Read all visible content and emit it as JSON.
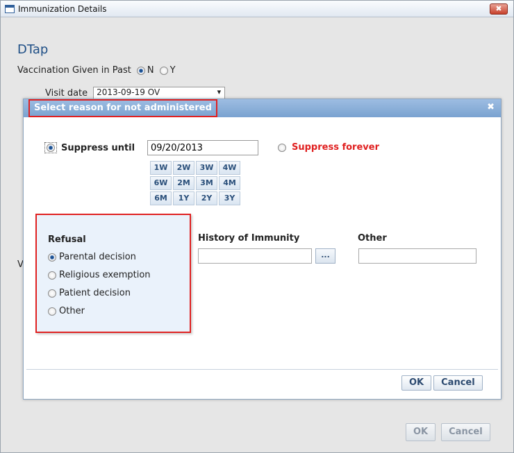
{
  "window": {
    "title": "Immunization Details",
    "close": "✖"
  },
  "vaccine": {
    "name": "DTap",
    "past_label": "Vaccination Given in Past",
    "past_options": [
      "N",
      "Y"
    ],
    "visit_label": "Visit date",
    "visit_value": "2013-09-19 OV",
    "partial_label": "V"
  },
  "outer_buttons": {
    "ok": "OK",
    "cancel": "Cancel"
  },
  "dialog": {
    "title": "Select reason for not administered",
    "close": "✖",
    "suppress_until_label": "Suppress until",
    "suppress_date": "09/20/2013",
    "suppress_forever_label": "Suppress forever",
    "periods": [
      "1W",
      "2W",
      "3W",
      "4W",
      "6W",
      "2M",
      "3M",
      "4M",
      "6M",
      "1Y",
      "2Y",
      "3Y"
    ],
    "refusal": {
      "title": "Refusal",
      "options": [
        "Parental decision",
        "Religious exemption",
        "Patient decision",
        "Other"
      ],
      "selected_index": 0
    },
    "history_label": "History of Immunity",
    "history_btn": "...",
    "other_label": "Other",
    "ok": "OK",
    "cancel": "Cancel"
  }
}
